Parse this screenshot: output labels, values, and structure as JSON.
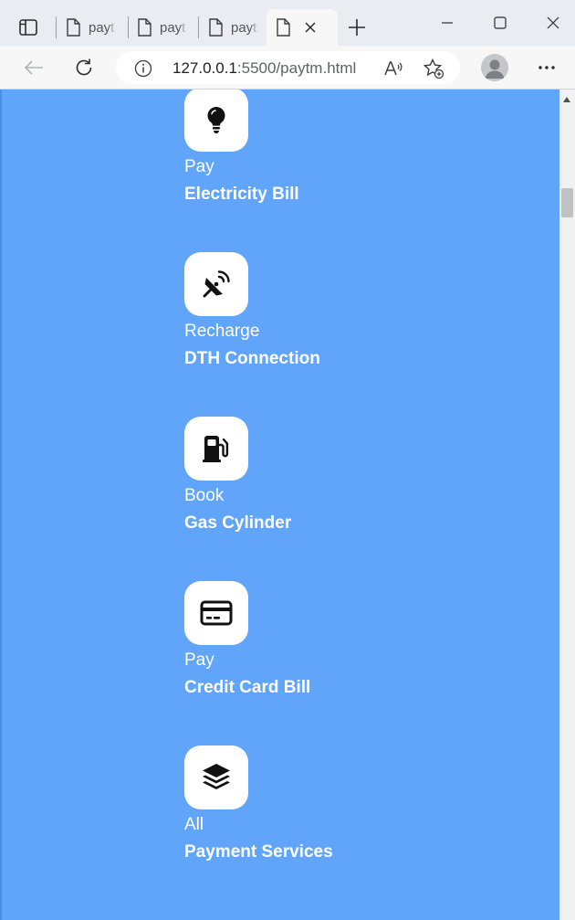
{
  "browser": {
    "tabs": [
      {
        "title": "paytm.html",
        "active": false
      },
      {
        "title": "paytm.html",
        "active": false
      },
      {
        "title": "paytm.html",
        "active": false
      },
      {
        "title": "",
        "active": true
      }
    ],
    "address": {
      "host": "127.0.0.1",
      "path": ":5500/paytm.html"
    },
    "icons": [
      "tab-actions-icon",
      "page-icon",
      "close-icon",
      "plus-icon",
      "minimize-icon",
      "maximize-icon",
      "window-close-icon",
      "back-arrow-icon",
      "refresh-icon",
      "info-icon",
      "read-aloud-icon",
      "favorite-add-icon",
      "profile-avatar-icon",
      "more-menu-icon"
    ]
  },
  "services": [
    {
      "icon": "bulb-icon",
      "line1": "Pay",
      "line2": "Electricity Bill"
    },
    {
      "icon": "satellite-dish-icon",
      "line1": "Recharge",
      "line2": "DTH Connection"
    },
    {
      "icon": "gas-pump-icon",
      "line1": "Book",
      "line2": "Gas Cylinder"
    },
    {
      "icon": "credit-card-icon",
      "line1": "Pay",
      "line2": "Credit Card Bill"
    },
    {
      "icon": "layers-icon",
      "line1": "All",
      "line2": "Payment Services"
    }
  ],
  "colors": {
    "page_background": "#61a5fa",
    "icon_tile": "#ffffff",
    "text": "#ffffff"
  }
}
